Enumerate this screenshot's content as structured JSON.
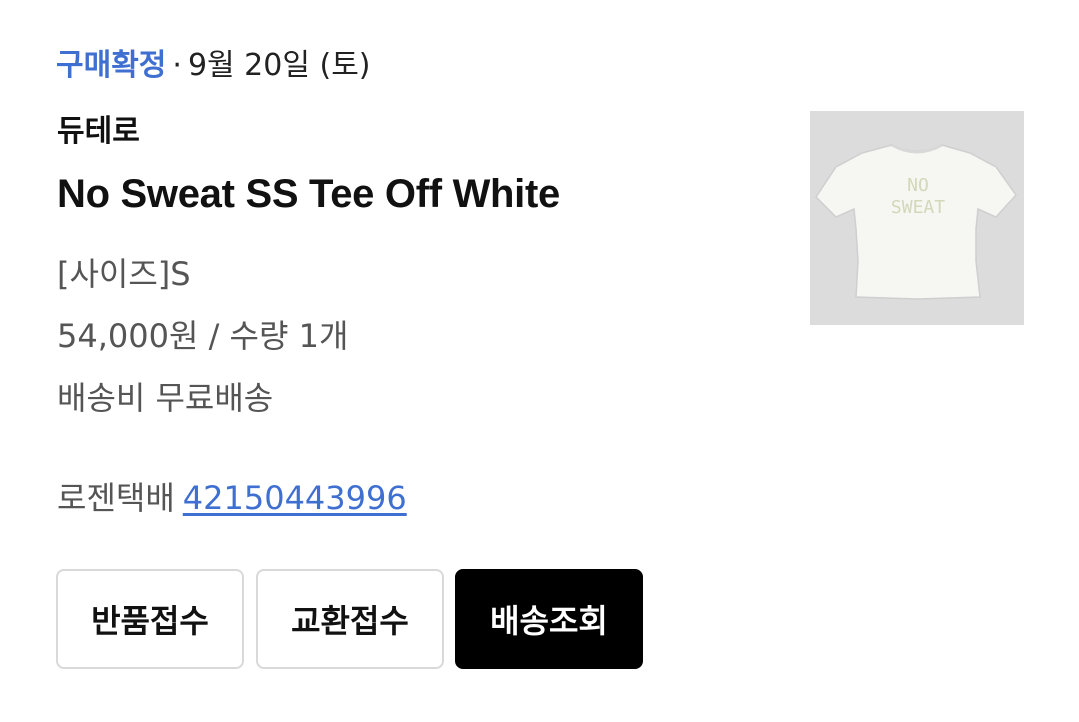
{
  "order": {
    "status": "구매확정",
    "separator": "·",
    "date": "9월 20일 (토)"
  },
  "product": {
    "brand": "듀테로",
    "name": "No Sweat SS Tee Off White",
    "option": "[사이즈]S",
    "price_qty": "54,000원 / 수량 1개",
    "shipping": "배송비 무료배송",
    "image_alt": "No Sweat SS Tee Off White 상품 이미지",
    "image_print": [
      "NO",
      "SWEAT"
    ]
  },
  "delivery": {
    "carrier": "로젠택배",
    "tracking_number": "42150443996"
  },
  "actions": {
    "return_label": "반품접수",
    "exchange_label": "교환접수",
    "track_label": "배송조회"
  },
  "colors": {
    "status_blue": "#3e6fd1",
    "link_blue": "#3e6fd1",
    "primary_button": "#000000",
    "thumbnail_bg": "#dcdcdc"
  }
}
